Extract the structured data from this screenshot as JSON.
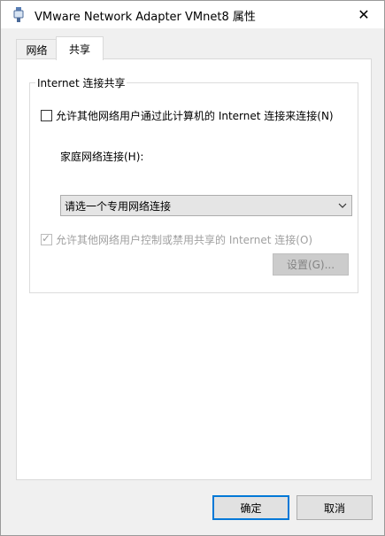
{
  "window": {
    "title": "VMware Network Adapter VMnet8 属性",
    "close_glyph": "✕"
  },
  "tabs": [
    {
      "label": "网络",
      "active": false
    },
    {
      "label": "共享",
      "active": true
    }
  ],
  "sharing": {
    "group_title": "Internet 连接共享",
    "allow_connect": {
      "label": "允许其他网络用户通过此计算机的 Internet 连接来连接(N)",
      "checked": false
    },
    "home_network_label": "家庭网络连接(H):",
    "home_network_select": {
      "value": "请选一个专用网络连接"
    },
    "allow_control": {
      "label": "允许其他网络用户控制或禁用共享的 Internet 连接(O)",
      "checked": true,
      "disabled": true
    },
    "settings_button": "设置(G)..."
  },
  "footer": {
    "ok_label": "确定",
    "cancel_label": "取消"
  },
  "icons": {
    "title_icon": "network-adapter-icon",
    "close_icon": "close-icon",
    "dropdown_icon": "chevron-down-icon"
  },
  "colors": {
    "accent": "#0078d7",
    "dialog_bg": "#f0f0f0",
    "disabled_text": "#a0a0a0"
  }
}
